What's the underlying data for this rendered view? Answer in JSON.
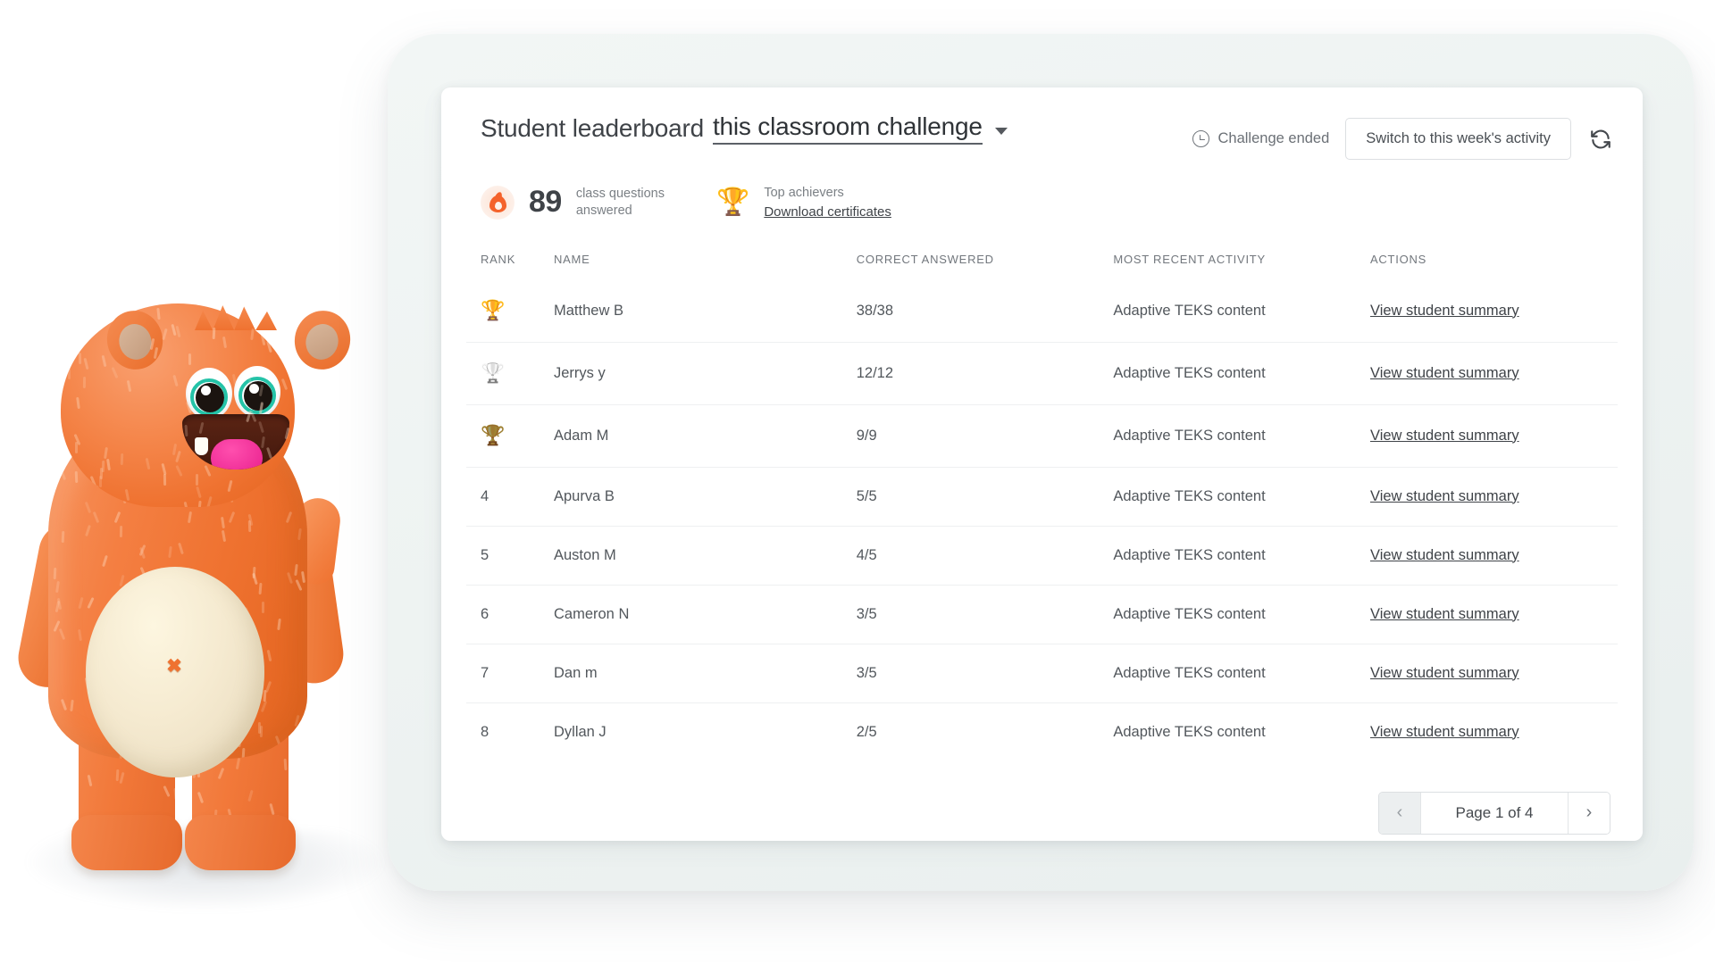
{
  "header": {
    "title_plain": "Student leaderboard",
    "title_selected": "this classroom challenge",
    "caret_icon": "chevron-down-icon",
    "status_text": "Challenge ended",
    "status_icon": "clock-icon",
    "switch_button": "Switch to this week's activity",
    "refresh_icon": "refresh-icon"
  },
  "stats": {
    "flame_icon": "flame-icon",
    "count": "89",
    "count_label_line1": "class questions",
    "count_label_line2": "answered",
    "trophy_icon": "trophy-award-icon",
    "achievers_label": "Top achievers",
    "download_link": "Download certificates"
  },
  "table": {
    "columns": [
      "RANK",
      "NAME",
      "CORRECT ANSWERED",
      "MOST RECENT ACTIVITY",
      "ACTIONS"
    ],
    "rows": [
      {
        "rank": "",
        "medal": "gold",
        "name": "Matthew B",
        "correct": "38/38",
        "activity": "Adaptive TEKS content",
        "action": "View student summary"
      },
      {
        "rank": "",
        "medal": "silver",
        "name": "Jerrys y",
        "correct": "12/12",
        "activity": "Adaptive TEKS content",
        "action": "View student summary"
      },
      {
        "rank": "",
        "medal": "bronze",
        "name": "Adam M",
        "correct": "9/9",
        "activity": "Adaptive TEKS content",
        "action": "View student summary"
      },
      {
        "rank": "4",
        "medal": "",
        "name": "Apurva B",
        "correct": "5/5",
        "activity": "Adaptive TEKS content",
        "action": "View student summary"
      },
      {
        "rank": "5",
        "medal": "",
        "name": "Auston M",
        "correct": "4/5",
        "activity": "Adaptive TEKS content",
        "action": "View student summary"
      },
      {
        "rank": "6",
        "medal": "",
        "name": "Cameron N",
        "correct": "3/5",
        "activity": "Adaptive TEKS content",
        "action": "View student summary"
      },
      {
        "rank": "7",
        "medal": "",
        "name": "Dan m",
        "correct": "3/5",
        "activity": "Adaptive TEKS content",
        "action": "View student summary"
      },
      {
        "rank": "8",
        "medal": "",
        "name": "Dyllan J",
        "correct": "2/5",
        "activity": "Adaptive TEKS content",
        "action": "View student summary"
      }
    ]
  },
  "pagination": {
    "prev_icon": "chevron-left-icon",
    "next_icon": "chevron-right-icon",
    "prev_label": "‹",
    "next_label": "›",
    "page_label": "Page 1 of 4",
    "prev_disabled": true
  },
  "mascot": {
    "name": "orange-monster-mascot",
    "body_color": "#ef7230",
    "belly_color": "#f5ead0",
    "eye_ring_color": "#24c3a8",
    "tongue_color": "#e81f8d"
  },
  "colors": {
    "device_shell": "#eef3f2",
    "card_background": "#ffffff",
    "text_primary": "#3f4348",
    "text_secondary": "#72777d",
    "row_divider": "#eef0f1",
    "accent_flame": "#f4622b",
    "medal_gold": "#f2c53d",
    "medal_silver": "#bcc0c4",
    "medal_bronze": "#8a7320"
  }
}
